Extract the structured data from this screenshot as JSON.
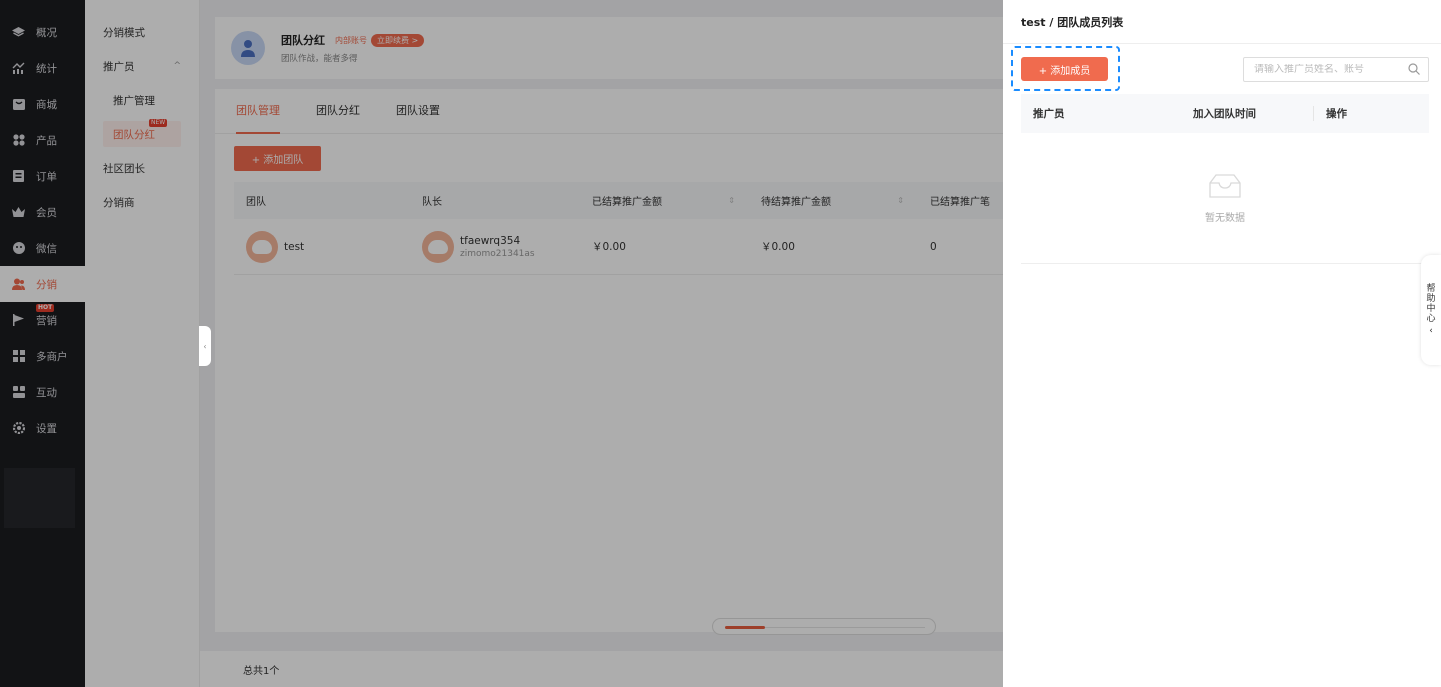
{
  "nav": {
    "items": [
      {
        "label": "概况",
        "icon": "layers-icon"
      },
      {
        "label": "统计",
        "icon": "stats-icon"
      },
      {
        "label": "商城",
        "icon": "shop-icon"
      },
      {
        "label": "产品",
        "icon": "product-icon"
      },
      {
        "label": "订单",
        "icon": "order-icon"
      },
      {
        "label": "会员",
        "icon": "crown-icon"
      },
      {
        "label": "微信",
        "icon": "wechat-icon"
      },
      {
        "label": "分销",
        "icon": "users-icon",
        "active": true
      },
      {
        "label": "营销",
        "icon": "flag-icon",
        "badge": "HOT"
      },
      {
        "label": "多商户",
        "icon": "store-icon"
      },
      {
        "label": "互动",
        "icon": "interact-icon"
      },
      {
        "label": "设置",
        "icon": "gear-icon"
      }
    ]
  },
  "subnav": {
    "mode": "分销模式",
    "promoter": "推广员",
    "promoter_manage": "推广管理",
    "team_dividend": "团队分红",
    "team_dividend_badge": "NEW",
    "community_leader": "社区团长",
    "distributor": "分销商"
  },
  "header": {
    "title": "团队分红",
    "tag": "内部账号",
    "renew": "立即续费 >",
    "subtitle": "团队作战，能者多得"
  },
  "tabs": [
    "团队管理",
    "团队分红",
    "团队设置"
  ],
  "add_team": "+ 添加团队",
  "table": {
    "columns": [
      "团队",
      "队长",
      "已结算推广金额",
      "待结算推广金额",
      "已结算推广笔"
    ],
    "rows": [
      {
        "team": "test",
        "leader": "tfaewrq354",
        "leader_account": "zimomo21341as",
        "settled": "￥0.00",
        "pending": "￥0.00",
        "count": "0"
      }
    ]
  },
  "footer_total": "总共1个",
  "drawer": {
    "title": "test / 团队成员列表",
    "add_member": "+ 添加成员",
    "search_placeholder": "请输入推广员姓名、账号",
    "columns": [
      "推广员",
      "加入团队时间",
      "操作"
    ],
    "empty": "暂无数据"
  },
  "help": [
    "帮",
    "助",
    "中",
    "心"
  ]
}
